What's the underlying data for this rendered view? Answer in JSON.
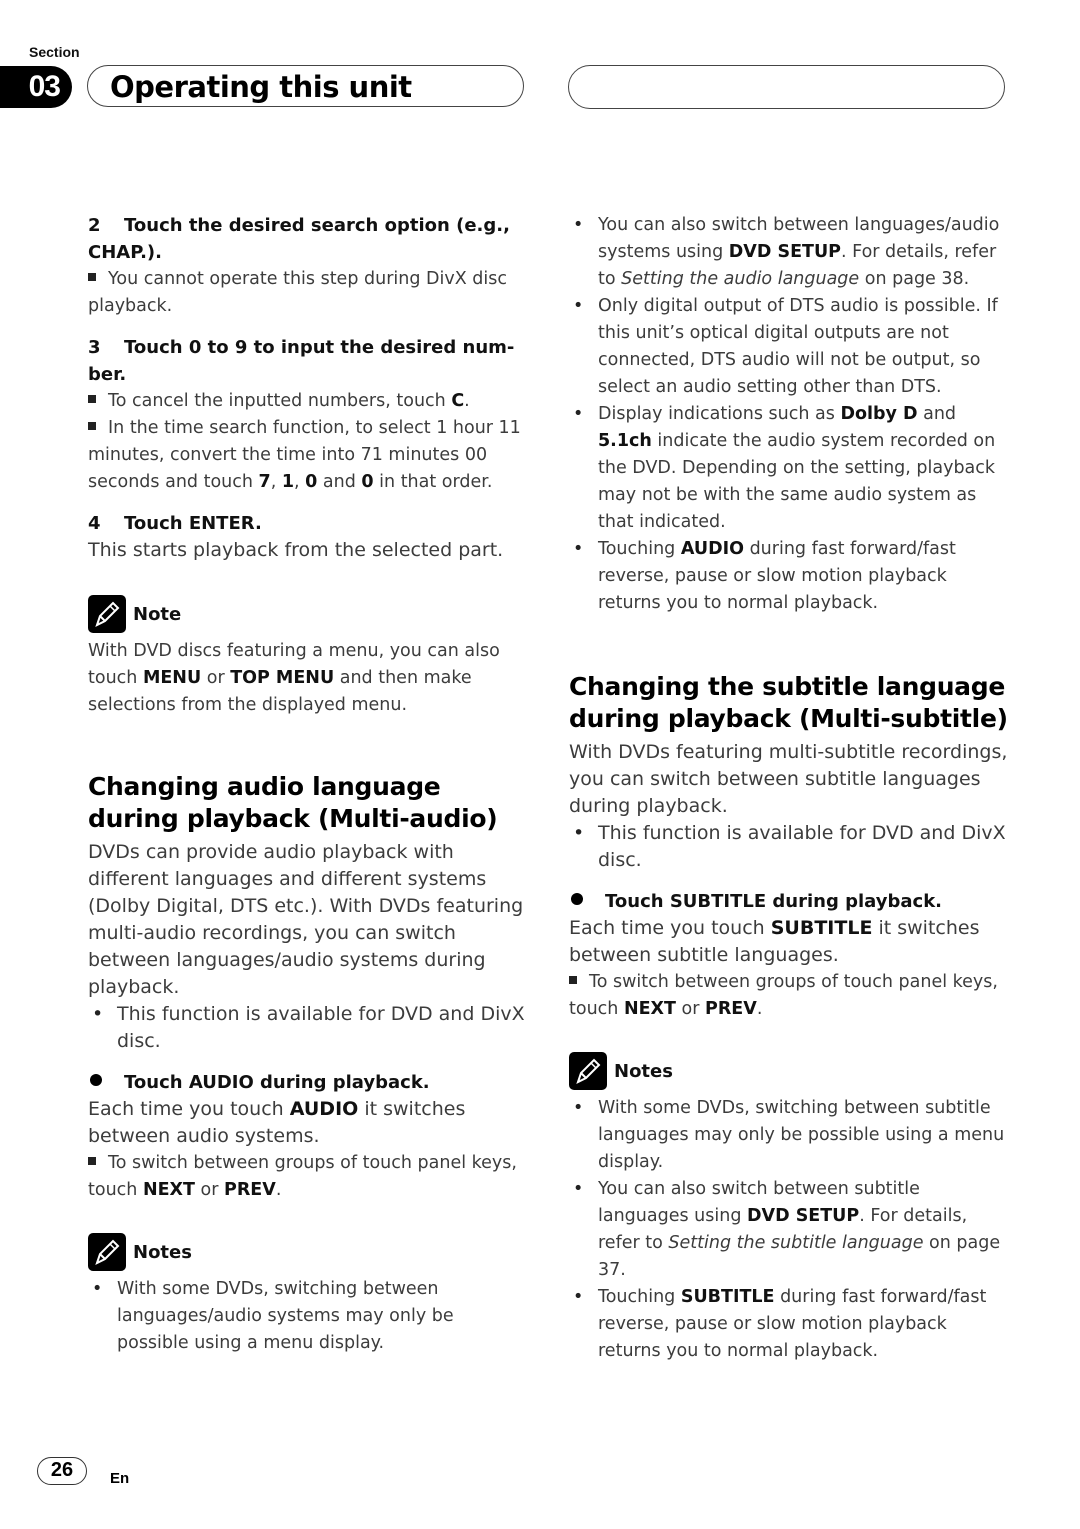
{
  "header": {
    "section_label": "Section",
    "section_number": "03",
    "title": "Operating this unit"
  },
  "left": {
    "step2": {
      "num": "2",
      "title_line1": "Touch the desired search option (e.g.,",
      "title_line2": "CHAP.).",
      "note": "You cannot operate this step during DivX disc playback."
    },
    "step3": {
      "num": "3",
      "title_line1": "Touch 0 to 9 to input the desired num-",
      "title_line2": "ber.",
      "note1_text": "To cancel the inputted numbers, touch ",
      "note1_bold": "C",
      "note1_end": ".",
      "note2_text1": "In the time search function, to  select 1 hour 11 minutes, convert the time into 71 minutes 00 seconds and touch ",
      "note2_b1": "7",
      "note2_sep1": ", ",
      "note2_b2": "1",
      "note2_sep2": ", ",
      "note2_b3": "0",
      "note2_and": " and ",
      "note2_b4": "0",
      "note2_end": " in that order."
    },
    "step4": {
      "num": "4",
      "title": "Touch ENTER.",
      "body": "This starts playback from the selected part."
    },
    "note": {
      "label": "Note",
      "text1": "With DVD discs featuring a menu, you can also touch ",
      "b1": "MENU",
      "text2": " or ",
      "b2": "TOP MENU",
      "text3": " and then make selections from the displayed menu."
    },
    "audio_section": {
      "heading_line1": "Changing audio language",
      "heading_line2": "during playback (Multi-audio)",
      "intro": "DVDs can provide audio playback with different languages and different systems (Dolby Digital, DTS etc.). With DVDs featuring multi-audio recordings, you can switch between languages/audio systems during playback.",
      "bullet": "This function is available for DVD and DivX disc.",
      "action": "Touch AUDIO during playback.",
      "action_body1": "Each time you touch ",
      "action_body_bold": "AUDIO",
      "action_body2": " it switches between audio systems.",
      "tip_text": "To switch between groups of touch panel keys, touch ",
      "tip_b1": "NEXT",
      "tip_or": " or ",
      "tip_b2": "PREV",
      "tip_end": "."
    },
    "notes": {
      "label": "Notes",
      "items": [
        "With some DVDs, switching between languages/audio systems may only be possible using a menu display."
      ]
    }
  },
  "right": {
    "bullets_top": {
      "item1_t1": "You can also switch between languages/audio systems using ",
      "item1_b": "DVD SETUP",
      "item1_t2": ". For details, refer to ",
      "item1_i": "Setting the audio language",
      "item1_t3": " on page 38.",
      "item2": "Only digital output of DTS audio is possible. If this unit’s optical digital outputs are not connected, DTS audio will not be output, so select an audio setting other than DTS.",
      "item3_t1": "Display indications such as ",
      "item3_b1": "Dolby D",
      "item3_t2": " and ",
      "item3_b2": "5.1ch",
      "item3_t3": " indicate the audio system recorded on the DVD. Depending on the setting, playback may not be with the same audio system as that indicated.",
      "item4_t1": "Touching ",
      "item4_b": "AUDIO",
      "item4_t2": " during fast forward/fast reverse, pause or slow motion playback returns you to normal playback."
    },
    "subtitle_section": {
      "heading_line1": "Changing the subtitle language",
      "heading_line2": "during playback (Multi-subtitle)",
      "intro": "With DVDs featuring multi-subtitle recordings, you can switch between subtitle languages during playback.",
      "bullet": "This function is available for DVD and DivX disc.",
      "action": "Touch SUBTITLE during playback.",
      "action_body1": "Each time you touch ",
      "action_body_bold": "SUBTITLE",
      "action_body2": " it switches between subtitle languages.",
      "tip_text": "To switch between groups of touch panel keys, touch ",
      "tip_b1": "NEXT",
      "tip_or": " or ",
      "tip_b2": "PREV",
      "tip_end": "."
    },
    "notes": {
      "label": "Notes",
      "item1": "With some DVDs, switching between subtitle languages may only be possible using a menu display.",
      "item2_t1": "You can also switch between subtitle languages using ",
      "item2_b": "DVD SETUP",
      "item2_t2": ". For details, refer to ",
      "item2_i": "Setting the subtitle language",
      "item2_t3": " on page 37.",
      "item3_t1": "Touching ",
      "item3_b": "SUBTITLE",
      "item3_t2": " during fast forward/fast reverse, pause or slow motion playback returns you to normal playback."
    }
  },
  "footer": {
    "page_number": "26",
    "language": "En"
  }
}
